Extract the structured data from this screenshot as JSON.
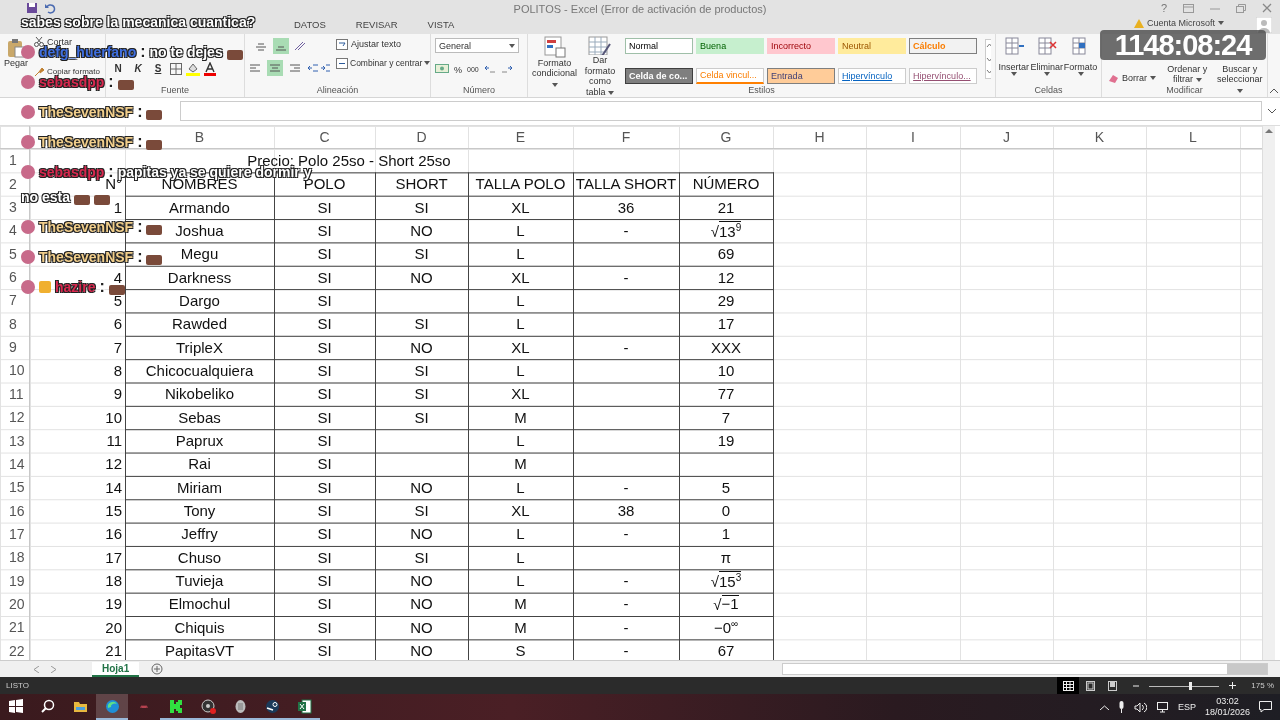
{
  "window": {
    "title": "POLITOS - Excel (Error de activación de productos)",
    "help": "?"
  },
  "ribbon_tabs": [
    {
      "label": "DATOS",
      "selected": false
    },
    {
      "label": "REVISAR",
      "selected": false
    },
    {
      "label": "VISTA",
      "selected": false
    }
  ],
  "account": "Cuenta Microsoft",
  "clipboard": {
    "paste": "Pegar",
    "cut": "Cortar",
    "format_painter": "Copiar formato"
  },
  "font": {
    "bold": "N",
    "italic": "K",
    "underline": "S",
    "label": "Fuente"
  },
  "alignment": {
    "v_align": [
      {
        "selected": false
      },
      {
        "selected": true
      }
    ],
    "h_align": [
      {
        "selected": false
      },
      {
        "selected": true
      },
      {
        "selected": false
      }
    ],
    "wrap": "Ajustar texto",
    "merge": "Combinar y centrar",
    "label": "Alineación"
  },
  "number": {
    "format": "General",
    "percent": "%",
    "thousands": "000",
    "label": "Número"
  },
  "styles": {
    "conditional": "Formato condicional",
    "as_table": "Dar formato como tabla",
    "label": "Estilos",
    "cells": [
      {
        "label": "Normal",
        "kind": "normal",
        "color": "#ffffff"
      },
      {
        "label": "Buena",
        "kind": "good",
        "color": "#c6efce"
      },
      {
        "label": "Incorrecto",
        "kind": "bad",
        "color": "#ffc7ce"
      },
      {
        "label": "Neutral",
        "kind": "neutral",
        "color": "#ffeb9c"
      },
      {
        "label": "Cálculo",
        "kind": "calc",
        "color": "#f2f2f2"
      },
      {
        "label": "Celda de co...",
        "kind": "check",
        "color": "#7f7f7f"
      },
      {
        "label": "Celda vincul...",
        "kind": "linked",
        "color": "#ffffff"
      },
      {
        "label": "Entrada",
        "kind": "input",
        "color": "#ffcc99"
      },
      {
        "label": "Hipervínculo",
        "kind": "link",
        "color": "#ffffff"
      },
      {
        "label": "Hipervínculo...",
        "kind": "visited",
        "color": "#ffffff"
      }
    ]
  },
  "cells_group": {
    "buttons": [
      "Insertar",
      "Eliminar",
      "Formato"
    ],
    "label": "Celdas"
  },
  "editing": {
    "clear": "Borrar",
    "sort": "Ordenar y filtrar",
    "find": "Buscar y seleccionar",
    "label": "Modificar"
  },
  "sheet": {
    "columns": [
      "B",
      "C",
      "D",
      "E",
      "F",
      "G",
      "H",
      "I",
      "J",
      "K",
      "L"
    ],
    "row_numbers": [
      "1",
      "2",
      "3",
      "4",
      "5",
      "6",
      "7",
      "8",
      "9",
      "10",
      "11",
      "12",
      "13",
      "14",
      "15",
      "16",
      "17",
      "18",
      "19",
      "20",
      "21",
      "22"
    ],
    "title": "Precio: Polo 25so - Short 25so",
    "headers": [
      "N°",
      "NOMBRES",
      "POLO",
      "SHORT",
      "TALLA POLO",
      "TALLA SHORT",
      "NÚMERO"
    ],
    "rows": [
      {
        "n": "1",
        "name": "Armando",
        "polo": "SI",
        "short": "SI",
        "talla_polo": "XL",
        "talla_short": "36",
        "numero": {
          "kind": "plain",
          "value": "21"
        }
      },
      {
        "name": "Joshua",
        "polo": "SI",
        "short": "NO",
        "talla_polo": "L",
        "talla_short": "-",
        "numero": {
          "kind": "radical",
          "sign": "√",
          "value": "13$^{9}$"
        }
      },
      {
        "name": "Megu",
        "polo": "SI",
        "short": "SI",
        "talla_polo": "L",
        "numero": {
          "kind": "plain",
          "value": "69"
        }
      },
      {
        "n": "4",
        "name": "Darkness",
        "polo": "SI",
        "short": "NO",
        "talla_polo": "XL",
        "talla_short": "-",
        "numero": {
          "kind": "plain",
          "value": "12"
        }
      },
      {
        "n": "5",
        "name": "Dargo",
        "polo": "SI",
        "talla_polo": "L",
        "numero": {
          "kind": "plain",
          "value": "29"
        }
      },
      {
        "n": "6",
        "name": "Rawded",
        "polo": "SI",
        "short": "SI",
        "talla_polo": "L",
        "numero": {
          "kind": "plain",
          "value": "17"
        }
      },
      {
        "n": "7",
        "name": "TripleX",
        "polo": "SI",
        "short": "NO",
        "talla_polo": "XL",
        "talla_short": "-",
        "numero": {
          "kind": "plain",
          "value": "XXX"
        }
      },
      {
        "n": "8",
        "name": "Chicocualquiera",
        "polo": "SI",
        "short": "SI",
        "talla_polo": "L",
        "numero": {
          "kind": "plain",
          "value": "10"
        }
      },
      {
        "n": "9",
        "name": "Nikobeliko",
        "polo": "SI",
        "short": "SI",
        "talla_polo": "XL",
        "numero": {
          "kind": "plain",
          "value": "77"
        }
      },
      {
        "n": "10",
        "name": "Sebas",
        "polo": "SI",
        "short": "SI",
        "talla_polo": "M",
        "numero": {
          "kind": "plain",
          "value": "7"
        }
      },
      {
        "n": "11",
        "name": "Paprux",
        "polo": "SI",
        "talla_polo": "L",
        "numero": {
          "kind": "plain",
          "value": "19"
        }
      },
      {
        "n": "12",
        "name": "Rai",
        "polo": "SI",
        "talla_polo": "M"
      },
      {
        "n": "14",
        "name": "Miriam",
        "polo": "SI",
        "short": "NO",
        "talla_polo": "L",
        "talla_short": "-",
        "numero": {
          "kind": "plain",
          "value": "5"
        }
      },
      {
        "n": "15",
        "name": "Tony",
        "polo": "SI",
        "short": "SI",
        "talla_polo": "XL",
        "talla_short": "38",
        "numero": {
          "kind": "plain",
          "value": "0"
        }
      },
      {
        "n": "16",
        "name": "Jeffry",
        "polo": "SI",
        "short": "NO",
        "talla_polo": "L",
        "talla_short": "-",
        "numero": {
          "kind": "plain",
          "value": "1"
        }
      },
      {
        "n": "17",
        "name": "Chuso",
        "polo": "SI",
        "short": "SI",
        "talla_polo": "L",
        "numero": {
          "kind": "plain",
          "value": "π"
        }
      },
      {
        "n": "18",
        "name": "Tuvieja",
        "polo": "SI",
        "short": "NO",
        "talla_polo": "L",
        "talla_short": "-",
        "numero": {
          "kind": "radical",
          "sign": "√",
          "value": "15$^{3}$"
        }
      },
      {
        "n": "19",
        "name": "Elmochul",
        "polo": "SI",
        "short": "NO",
        "talla_polo": "M",
        "talla_short": "-",
        "numero": {
          "kind": "radical",
          "sign": "√",
          "value": "−1"
        }
      },
      {
        "n": "20",
        "name": "Chiquis",
        "polo": "SI",
        "short": "NO",
        "talla_polo": "M",
        "talla_short": "-",
        "numero": {
          "kind": "plain",
          "value": "−0$^{∞}$"
        }
      },
      {
        "n": "21",
        "name": "PapitasVT",
        "polo": "SI",
        "short": "NO",
        "talla_polo": "S",
        "talla_short": "-",
        "numero": {
          "kind": "plain",
          "value": "67"
        }
      }
    ]
  },
  "sheet_tabs": [
    {
      "label": "Hoja1",
      "selected": true
    }
  ],
  "status_bar": {
    "text": "LISTO",
    "views": [
      {
        "kind": "normal",
        "selected": true
      },
      {
        "kind": "layout",
        "selected": false
      },
      {
        "kind": "pagebreak",
        "selected": false
      }
    ],
    "zoom": {
      "level": 0.6,
      "label": "175 %"
    }
  },
  "taskbar": {
    "apps": [
      {
        "kind": "search",
        "open": false,
        "selected": false
      },
      {
        "kind": "folder",
        "open": false,
        "selected": false
      },
      {
        "kind": "browser",
        "open": true,
        "selected": true
      },
      {
        "kind": "small",
        "open": false,
        "selected": false
      },
      {
        "kind": "kick",
        "open": true,
        "selected": false
      },
      {
        "kind": "recorder",
        "open": true,
        "selected": false
      },
      {
        "kind": "speaker",
        "open": true,
        "selected": false
      },
      {
        "kind": "steam",
        "open": true,
        "selected": false
      },
      {
        "kind": "excel",
        "open": true,
        "selected": false
      }
    ],
    "language": "ESP",
    "time": "03:02",
    "date": "18/01/2026"
  },
  "timer": "1148:08:24",
  "chat": [
    {
      "lines": [
        [
          {
            "kind": "text",
            "text": "sabes sobre la mecanica cuantica?"
          }
        ]
      ]
    },
    {
      "user": "defg_huerfano",
      "color": "#3f6fe0",
      "separator": ":",
      "badge": false,
      "lines": [
        [
          {
            "kind": "text",
            "text": "no te dejes"
          },
          {
            "kind": "emote"
          }
        ]
      ]
    },
    {
      "user": "sebasdpp",
      "color": "#d8284f",
      "separator": ":",
      "badge": false,
      "lines": [
        [
          {
            "kind": "emote"
          }
        ]
      ]
    },
    {
      "user": "TheSevenNSF",
      "color": "#f2cf8c",
      "separator": ":",
      "badge": false,
      "lines": [
        [
          {
            "kind": "emote"
          }
        ]
      ]
    },
    {
      "user": "TheSevenNSF",
      "color": "#f2cf8c",
      "separator": ":",
      "badge": false,
      "lines": [
        [
          {
            "kind": "emote"
          }
        ]
      ]
    },
    {
      "user": "sebasdpp",
      "color": "#d8284f",
      "separator": ":",
      "badge": false,
      "lines": [
        [
          {
            "kind": "text",
            "text": "papitas ya se quiere dormir y"
          }
        ],
        [
          {
            "kind": "text",
            "text": "no esta"
          },
          {
            "kind": "emote"
          },
          {
            "kind": "emote"
          }
        ]
      ]
    },
    {
      "user": "TheSevenNSF",
      "color": "#f2cf8c",
      "separator": ":",
      "badge": false,
      "lines": [
        [
          {
            "kind": "emote"
          }
        ]
      ]
    },
    {
      "user": "TheSevenNSF",
      "color": "#f2cf8c",
      "separator": ":",
      "badge": false,
      "lines": [
        [
          {
            "kind": "emote"
          }
        ]
      ]
    },
    {
      "user": "hazire",
      "color": "#d8284f",
      "separator": ":",
      "badge": true,
      "lines": [
        [
          {
            "kind": "emote"
          }
        ]
      ]
    }
  ]
}
